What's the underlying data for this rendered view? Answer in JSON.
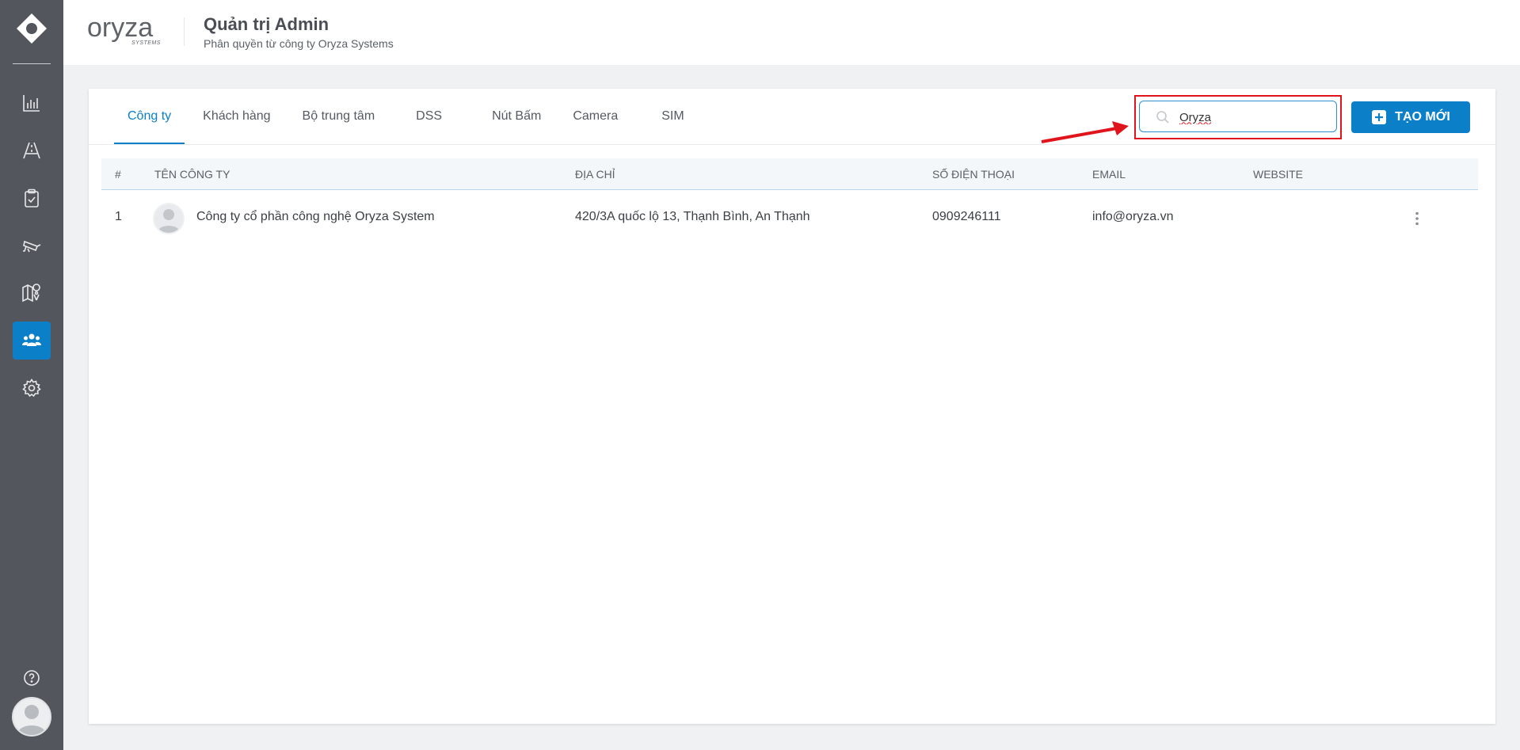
{
  "header": {
    "brand": "oryza",
    "brand_tagline": "SYSTEMS",
    "title": "Quản trị Admin",
    "subtitle": "Phân quyền từ công ty Oryza Systems"
  },
  "sidebar": {
    "items": [
      {
        "icon": "bar-chart-icon"
      },
      {
        "icon": "road-icon"
      },
      {
        "icon": "clipboard-check-icon"
      },
      {
        "icon": "cctv-camera-icon"
      },
      {
        "icon": "map-pin-icon"
      },
      {
        "icon": "users-icon",
        "active": true
      },
      {
        "icon": "gear-icon"
      }
    ],
    "help_icon": "question-circle-icon",
    "avatar_icon": "user-avatar-icon"
  },
  "tabs": [
    {
      "label": "Công ty",
      "active": true
    },
    {
      "label": "Khách hàng"
    },
    {
      "label": "Bộ trung tâm"
    },
    {
      "label": "DSS"
    },
    {
      "label": "Nút Bấm"
    },
    {
      "label": "Camera"
    },
    {
      "label": "SIM"
    }
  ],
  "search": {
    "value": "Oryza"
  },
  "create_button": {
    "label": "TẠO MỚI"
  },
  "table": {
    "columns": [
      "#",
      "TÊN CÔNG TY",
      "ĐỊA CHỈ",
      "SỐ ĐIỆN THOẠI",
      "EMAIL",
      "WEBSITE"
    ],
    "rows": [
      {
        "index": "1",
        "name": "Công ty cổ phần công nghệ Oryza System",
        "address": "420/3A quốc lộ 13, Thạnh Bình, An Thạnh",
        "phone": "0909246111",
        "email": "info@oryza.vn",
        "website": ""
      }
    ]
  },
  "colors": {
    "sidebar_bg": "#53575d",
    "accent": "#0b7fc7",
    "highlight": "#e0141b"
  }
}
